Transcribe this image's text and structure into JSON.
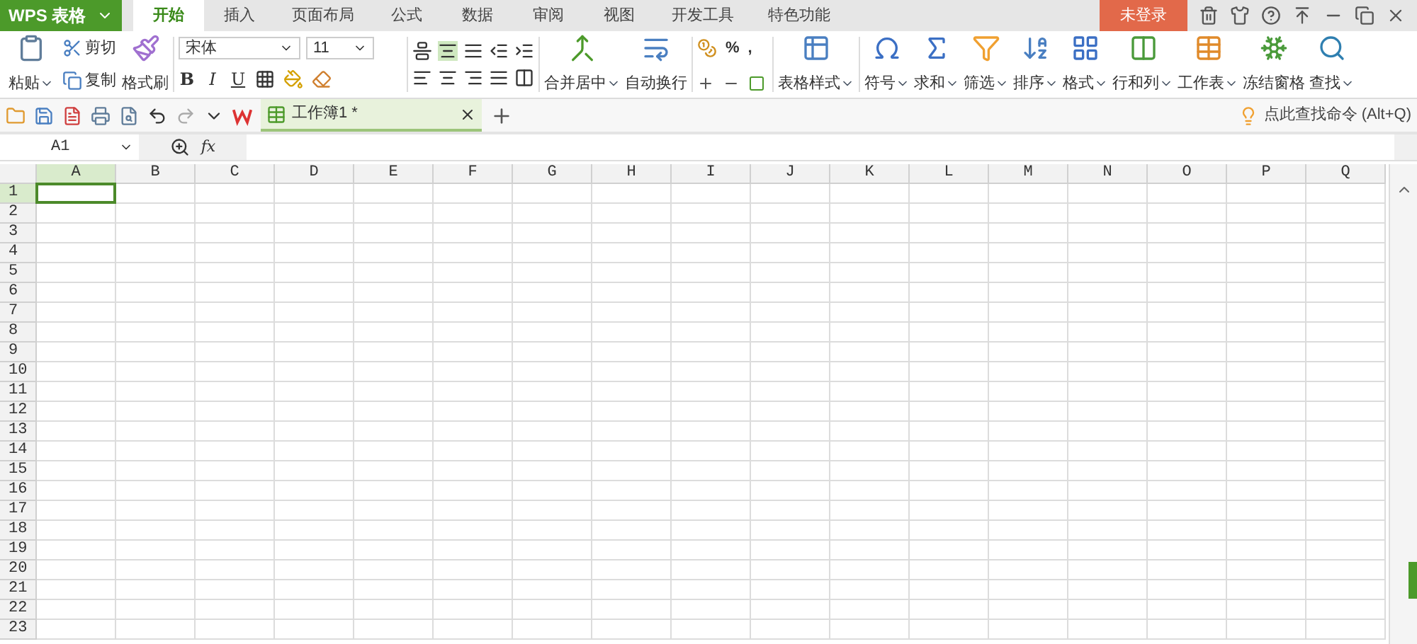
{
  "app": {
    "logo": "WPS 表格"
  },
  "tabs": [
    {
      "label": "开始",
      "selected": true
    },
    {
      "label": "插入",
      "selected": false
    },
    {
      "label": "页面布局",
      "selected": false
    },
    {
      "label": "公式",
      "selected": false
    },
    {
      "label": "数据",
      "selected": false
    },
    {
      "label": "审阅",
      "selected": false
    },
    {
      "label": "视图",
      "selected": false
    },
    {
      "label": "开发工具",
      "selected": false
    },
    {
      "label": "特色功能",
      "selected": false
    }
  ],
  "login_button": "未登录",
  "ribbon": {
    "paste": {
      "label": "粘贴",
      "dropdown": true
    },
    "cut": "剪切",
    "copy": "复制",
    "format_painter": "格式刷",
    "font": {
      "name": "宋体",
      "size": "11"
    },
    "font_buttons": [
      "B",
      "I",
      "U"
    ],
    "merge": {
      "label": "合并居中",
      "dropdown": true
    },
    "wrap": {
      "label": "自动换行",
      "dropdown": false
    },
    "number_symbols": [
      "%",
      ","
    ],
    "big_buttons": [
      {
        "label": "表格样式",
        "dropdown": true
      },
      {
        "label": "符号",
        "dropdown": true
      },
      {
        "label": "求和",
        "dropdown": true
      },
      {
        "label": "筛选",
        "dropdown": true
      },
      {
        "label": "排序",
        "dropdown": true
      },
      {
        "label": "格式",
        "dropdown": true
      },
      {
        "label": "行和列",
        "dropdown": true
      },
      {
        "label": "工作表",
        "dropdown": true
      },
      {
        "label": "冻结窗格",
        "dropdown": false
      },
      {
        "label": "查找",
        "dropdown": true
      }
    ]
  },
  "doc_tabs": [
    {
      "title": "工作簿1 *",
      "selected": true
    }
  ],
  "command_search": {
    "placeholder": "点此查找命令 (Alt+Q)"
  },
  "formula_bar": {
    "name_box": "A1",
    "fx": "fx"
  },
  "sheet": {
    "columns": [
      {
        "label": "A",
        "selected": true
      },
      {
        "label": "B",
        "selected": false
      },
      {
        "label": "C",
        "selected": false
      },
      {
        "label": "D",
        "selected": false
      },
      {
        "label": "E",
        "selected": false
      },
      {
        "label": "F",
        "selected": false
      },
      {
        "label": "G",
        "selected": false
      },
      {
        "label": "H",
        "selected": false
      },
      {
        "label": "I",
        "selected": false
      },
      {
        "label": "J",
        "selected": false
      },
      {
        "label": "K",
        "selected": false
      },
      {
        "label": "L",
        "selected": false
      },
      {
        "label": "M",
        "selected": false
      },
      {
        "label": "N",
        "selected": false
      },
      {
        "label": "O",
        "selected": false
      },
      {
        "label": "P",
        "selected": false
      },
      {
        "label": "Q",
        "selected": false
      }
    ],
    "rows": [
      {
        "label": "1",
        "selected": true
      },
      {
        "label": "2",
        "selected": false
      },
      {
        "label": "3",
        "selected": false
      },
      {
        "label": "4",
        "selected": false
      },
      {
        "label": "5",
        "selected": false
      },
      {
        "label": "6",
        "selected": false
      },
      {
        "label": "7",
        "selected": false
      },
      {
        "label": "8",
        "selected": false
      },
      {
        "label": "9",
        "selected": false
      },
      {
        "label": "10",
        "selected": false
      },
      {
        "label": "11",
        "selected": false
      },
      {
        "label": "12",
        "selected": false
      },
      {
        "label": "13",
        "selected": false
      },
      {
        "label": "14",
        "selected": false
      },
      {
        "label": "15",
        "selected": false
      },
      {
        "label": "16",
        "selected": false
      },
      {
        "label": "17",
        "selected": false
      },
      {
        "label": "18",
        "selected": false
      },
      {
        "label": "19",
        "selected": false
      },
      {
        "label": "20",
        "selected": false
      },
      {
        "label": "21",
        "selected": false
      },
      {
        "label": "22",
        "selected": false
      },
      {
        "label": "23",
        "selected": false
      }
    ]
  }
}
